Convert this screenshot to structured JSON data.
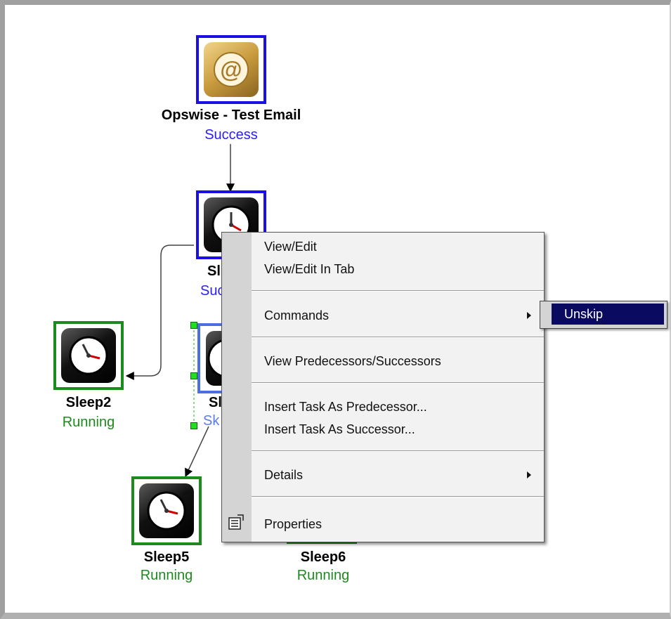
{
  "nodes": {
    "email": {
      "name": "Opswise - Test Email",
      "status": "Success",
      "icon": "email-at-icon"
    },
    "sleep1": {
      "name": "Sl",
      "status": "Suc",
      "icon": "clock-icon"
    },
    "sleep2": {
      "name": "Sleep2",
      "status": "Running",
      "icon": "clock-icon"
    },
    "sleep3": {
      "name": "Sl",
      "status": "Sk",
      "icon": "clock-icon"
    },
    "sleep5": {
      "name": "Sleep5",
      "status": "Running",
      "icon": "clock-icon"
    },
    "sleep6": {
      "name": "Sleep6",
      "status": "Running",
      "icon": "clock-icon"
    }
  },
  "context_menu": {
    "view_edit": "View/Edit",
    "view_edit_tab": "View/Edit In Tab",
    "commands": "Commands",
    "view_pred_succ": "View Predecessors/Successors",
    "insert_pred": "Insert Task As Predecessor...",
    "insert_succ": "Insert Task As Successor...",
    "details": "Details",
    "properties": "Properties",
    "properties_icon": "properties-icon",
    "submenu_arrow_icon": "chevron-right-icon"
  },
  "submenu": {
    "unskip": "Unskip"
  },
  "colors": {
    "success_border": "#1a10e6",
    "running_border": "#1d8a1d",
    "success_text": "#2a1ff0",
    "running_text": "#1d8a1d",
    "submenu_highlight": "#0a0a60"
  }
}
